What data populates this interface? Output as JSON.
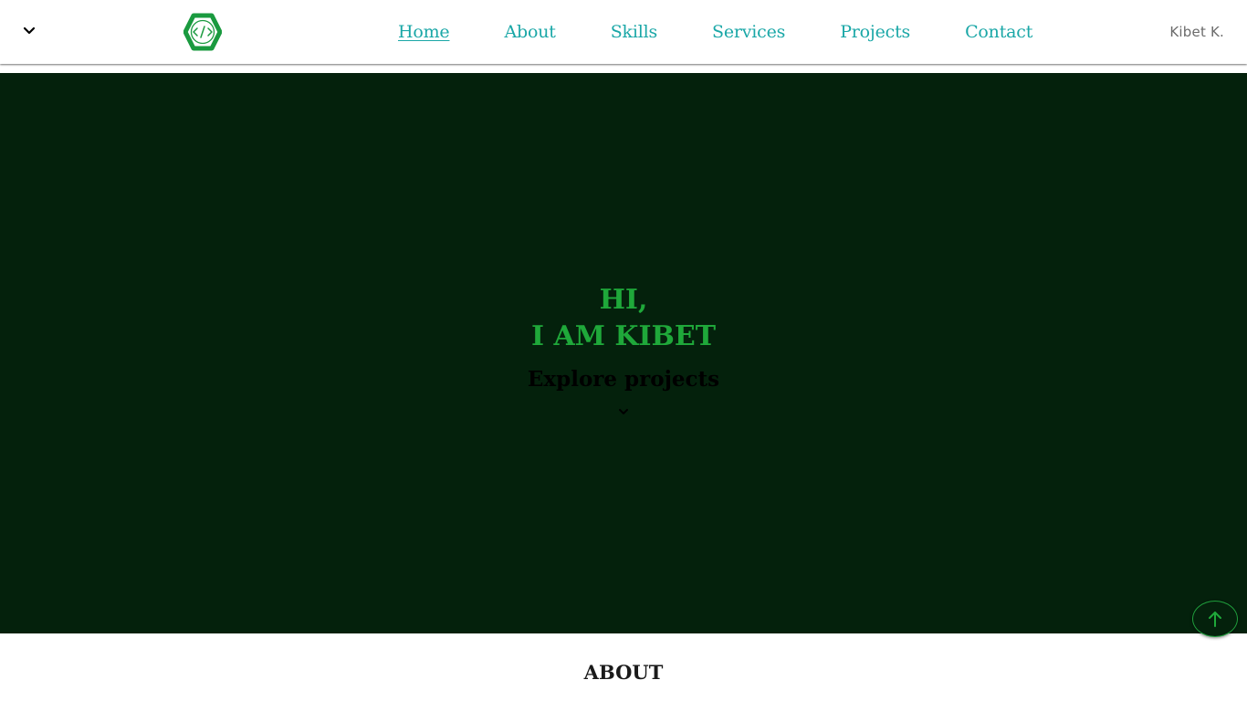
{
  "header": {
    "menu_icon": "chevron-down-icon",
    "logo_icon": "code-hexagon-logo",
    "nav": [
      {
        "label": "Home",
        "active": true
      },
      {
        "label": "About",
        "active": false
      },
      {
        "label": "Skills",
        "active": false
      },
      {
        "label": "Services",
        "active": false
      },
      {
        "label": "Projects",
        "active": false
      },
      {
        "label": "Contact",
        "active": false
      }
    ],
    "brand_name": "Kibet K."
  },
  "hero": {
    "greeting_line1": "HI,",
    "greeting_line2": "I AM KIBET",
    "cta_label": "Explore projects",
    "cta_icon": "chevron-down-icon"
  },
  "back_to_top": {
    "icon": "arrow-up-icon"
  },
  "about": {
    "title": "ABOUT"
  },
  "colors": {
    "hero_bg": "#04210c",
    "accent_green": "#1fa83a",
    "nav_link": "#1aa7a7",
    "logo_green": "#1a9a3f"
  }
}
